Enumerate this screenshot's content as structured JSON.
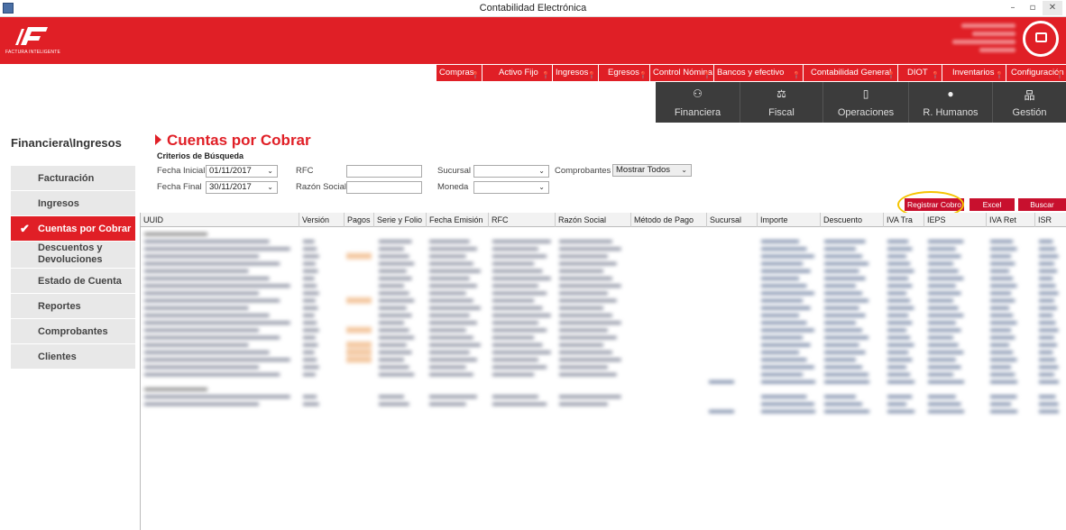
{
  "window": {
    "title": "Contabilidad Electrónica",
    "minimize": "–",
    "maximize": "▫",
    "close": "✕"
  },
  "brand": {
    "logo_text": "FACTURA INTELIGENTE"
  },
  "top_menu": [
    {
      "label": "Compras"
    },
    {
      "label": "Activo Fijo"
    },
    {
      "label": "Ingresos"
    },
    {
      "label": "Egresos"
    },
    {
      "label": "Control Nómina"
    },
    {
      "label": "Bancos y efectivo"
    },
    {
      "label": "Contabilidad General"
    },
    {
      "label": "DIOT"
    },
    {
      "label": "Inventarios"
    },
    {
      "label": "Configuración"
    }
  ],
  "modules": [
    {
      "label": "Financiera",
      "icon": "coins-icon"
    },
    {
      "label": "Fiscal",
      "icon": "scales-icon"
    },
    {
      "label": "Operaciones",
      "icon": "device-icon"
    },
    {
      "label": "R. Humanos",
      "icon": "person-icon"
    },
    {
      "label": "Gestión",
      "icon": "org-chart-icon"
    }
  ],
  "breadcrumb": "Financiera\\Ingresos",
  "sidebar": [
    {
      "label": "Facturación"
    },
    {
      "label": "Ingresos"
    },
    {
      "label": "Cuentas por Cobrar",
      "active": true
    },
    {
      "label": "Descuentos y Devoluciones"
    },
    {
      "label": "Estado de Cuenta"
    },
    {
      "label": "Reportes"
    },
    {
      "label": "Comprobantes"
    },
    {
      "label": "Clientes"
    }
  ],
  "page_title": "Cuentas por Cobrar",
  "criteria": {
    "heading": "Criterios de Búsqueda",
    "fecha_inicial_label": "Fecha Inicial",
    "fecha_inicial": "01/11/2017",
    "fecha_final_label": "Fecha Final",
    "fecha_final": "30/11/2017",
    "rfc_label": "RFC",
    "razon_label": "Razón Social",
    "sucursal_label": "Sucursal",
    "moneda_label": "Moneda",
    "comprobantes_label": "Comprobantes",
    "comprobantes_value": "Mostrar Todos"
  },
  "actions": {
    "registrar": "Registrar Cobro",
    "excel": "Excel",
    "buscar": "Buscar"
  },
  "grid": {
    "columns": [
      "UUID",
      "Versión",
      "Pagos",
      "Serie y Folio",
      "Fecha Emisión",
      "RFC",
      "Razón Social",
      "Método de Pago",
      "Sucursal",
      "Importe",
      "Descuento",
      "IVA Tra",
      "IEPS",
      "IVA Ret",
      "ISR"
    ]
  },
  "colors": {
    "brand_red": "#e01f26",
    "dark_module": "#3c3c3c",
    "highlight_ring": "#f5c400"
  }
}
